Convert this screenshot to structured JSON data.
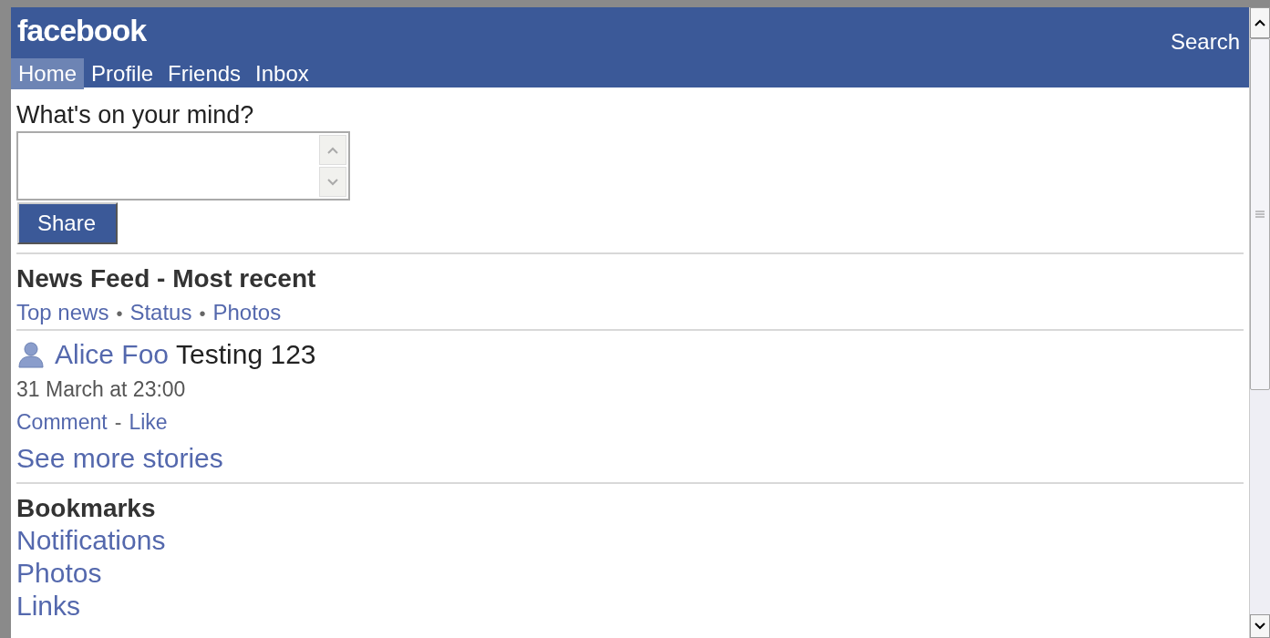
{
  "header": {
    "logo": "facebook",
    "search": "Search",
    "tabs": [
      {
        "label": "Home",
        "selected": true
      },
      {
        "label": "Profile",
        "selected": false
      },
      {
        "label": "Friends",
        "selected": false
      },
      {
        "label": "Inbox",
        "selected": false
      }
    ]
  },
  "composer": {
    "prompt": "What's on your mind?",
    "button": "Share"
  },
  "news_feed": {
    "title": "News Feed - Most recent",
    "filter_separator": "•",
    "filters": [
      "Top news",
      "Status",
      "Photos"
    ],
    "stories": [
      {
        "author": "Alice Foo",
        "text": "Testing 123",
        "time": "31 March at 23:00",
        "action_separator": "-",
        "actions": [
          "Comment",
          "Like"
        ]
      }
    ],
    "more": "See more stories"
  },
  "bookmarks": {
    "title": "Bookmarks",
    "items": [
      "Notifications",
      "Photos",
      "Links"
    ]
  }
}
